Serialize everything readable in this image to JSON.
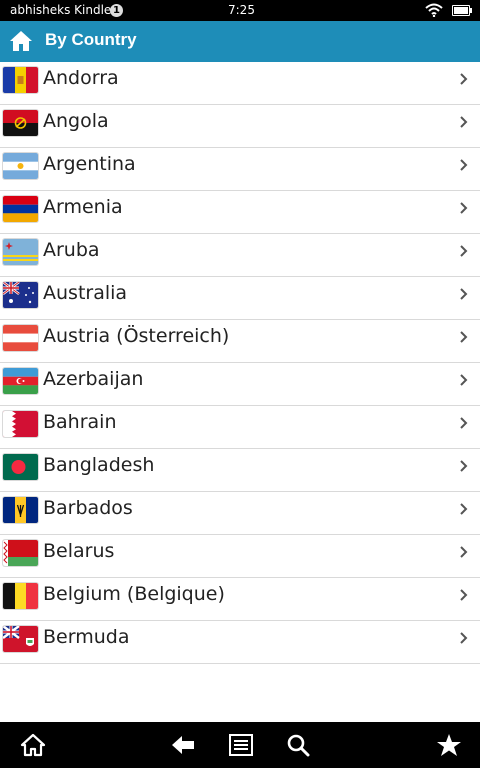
{
  "status": {
    "device_name": "abhisheks Kindle",
    "notification_count": "1",
    "time": "7:25"
  },
  "header": {
    "title": "By Country",
    "icon": "home-icon"
  },
  "countries": [
    {
      "name": "Andorra"
    },
    {
      "name": "Angola"
    },
    {
      "name": "Argentina"
    },
    {
      "name": "Armenia"
    },
    {
      "name": "Aruba"
    },
    {
      "name": "Australia"
    },
    {
      "name": "Austria (Österreich)"
    },
    {
      "name": "Azerbaijan"
    },
    {
      "name": "Bahrain"
    },
    {
      "name": "Bangladesh"
    },
    {
      "name": "Barbados"
    },
    {
      "name": "Belarus"
    },
    {
      "name": "Belgium (Belgique)"
    },
    {
      "name": "Bermuda"
    }
  ],
  "bottom_nav": [
    "home-icon",
    "back-icon",
    "menu-icon",
    "search-icon",
    "favorites-icon"
  ],
  "colors": {
    "header_bg": "#1e8db8",
    "status_bg": "#000000",
    "bottom_bg": "#000000",
    "row_divider": "#d9d9d9"
  }
}
